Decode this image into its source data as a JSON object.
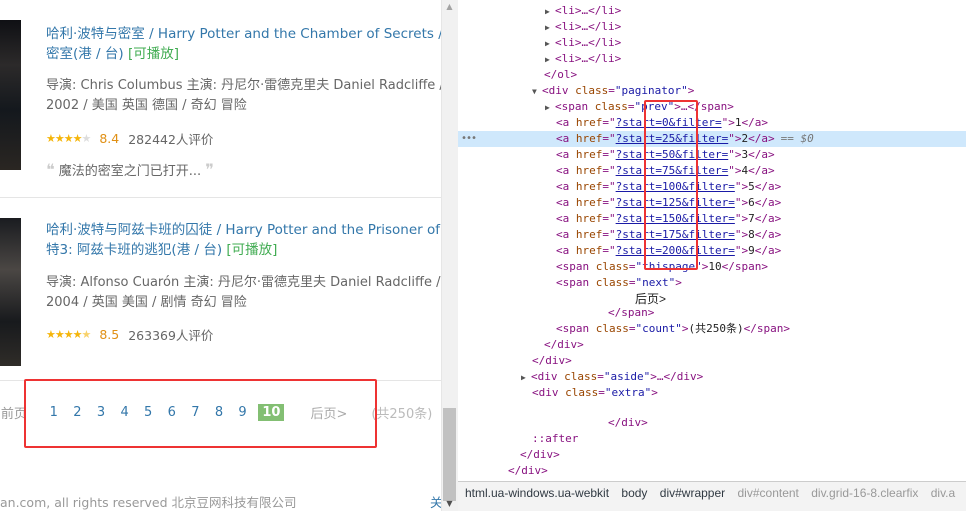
{
  "movies": [
    {
      "title_cn": "哈利·波特与密室",
      "title_en": "/ Harry Potter and the Chamber of Secrets",
      "title_more": "/ 哈",
      "title_line2": "密室(港 / 台)",
      "playable": "[可播放]",
      "director_line": "导演: Chris Columbus   主演: 丹尼尔·雷德克里夫 Daniel Radcliffe / 艾",
      "info_line": "2002 / 美国 英国 德国 / 奇幻 冒险",
      "stars": 4,
      "score": "8.4",
      "votes": "282442人评价",
      "quote": "魔法的密室之门已打开..."
    },
    {
      "title_cn": "哈利·波特与阿兹卡班的囚徒",
      "title_en": "/ Harry Potter and the Prisoner of A",
      "title_more": "",
      "title_line2": "特3: 阿兹卡班的逃犯(港 / 台)",
      "playable": "[可播放]",
      "director_line": "导演: Alfonso Cuarón   主演: 丹尼尔·雷德克里夫 Daniel Radcliffe / Em",
      "info_line": "2004 / 英国 美国 / 剧情 奇幻 冒险",
      "stars": 4.5,
      "score": "8.5",
      "votes": "263369人评价",
      "quote": ""
    }
  ],
  "pager": {
    "prev": "<前页",
    "pages": [
      "1",
      "2",
      "3",
      "4",
      "5",
      "6",
      "7",
      "8",
      "9"
    ],
    "current": "10",
    "next": "后页>",
    "count": "(共250条)"
  },
  "footer": {
    "copyright": "an.com, all rights reserved 北京豆网科技有限公司",
    "right": "关"
  },
  "devtools": {
    "li_lines": [
      "<li>…</li>",
      "<li>…</li>",
      "<li>…</li>",
      "<li>…</li>"
    ],
    "ol_close": "</ol>",
    "paginator_open": {
      "tag": "<div",
      "attr": "class",
      "val": "\"paginator\"",
      "end": ">"
    },
    "prev_span": {
      "tag": "<span",
      "attr": "class",
      "val": "\"prev\"",
      "mid": ">…</",
      "end": "span>"
    },
    "links": [
      {
        "href": "?start=0&filter=",
        "text": "1",
        "suffix": ""
      },
      {
        "href": "?start=25&filter=",
        "text": "2",
        "suffix": "== $0"
      },
      {
        "href": "?start=50&filter=",
        "text": "3",
        "suffix": ""
      },
      {
        "href": "?start=75&filter=",
        "text": "4",
        "suffix": ""
      },
      {
        "href": "?start=100&filter=",
        "text": "5",
        "suffix": ""
      },
      {
        "href": "?start=125&filter=",
        "text": "6",
        "suffix": ""
      },
      {
        "href": "?start=150&filter=",
        "text": "7",
        "suffix": ""
      },
      {
        "href": "?start=175&filter=",
        "text": "8",
        "suffix": ""
      },
      {
        "href": "?start=200&filter=",
        "text": "9",
        "suffix": ""
      }
    ],
    "thispage": {
      "val": "\"thispage\"",
      "text": "10"
    },
    "next_span": {
      "val": "\"next\"",
      "text": "后页>"
    },
    "span_close": "</span>",
    "count_span": {
      "val": "\"count\"",
      "text": "(共250条)"
    },
    "div_close": "</div>",
    "aside": {
      "val": "\"aside\"",
      "mid": ">…</"
    },
    "extra": {
      "val": "\"extra\""
    },
    "after": "::after",
    "breadcrumbs": [
      "html.ua-windows.ua-webkit",
      "body",
      "div#wrapper",
      "div#content",
      "div.grid-16-8.clearfix",
      "div.a"
    ]
  },
  "colors": {
    "link": "#3377aa",
    "green_current": "#83bf73",
    "highlight_box": "#ee3333",
    "selected_row": "#cfe8fc"
  }
}
